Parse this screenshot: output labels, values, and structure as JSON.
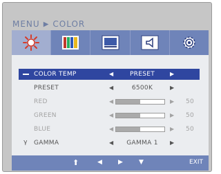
{
  "breadcrumb": {
    "menu": "MENU",
    "separator": "▶",
    "section": "COLOR"
  },
  "tabs": [
    {
      "icon": "brightness-sun-icon",
      "active": true
    },
    {
      "icon": "color-bars-icon",
      "active": false
    },
    {
      "icon": "monitor-picture-icon",
      "active": false
    },
    {
      "icon": "speaker-volume-icon",
      "active": false
    },
    {
      "icon": "settings-gear-icon",
      "active": false
    }
  ],
  "rows": [
    {
      "label": "COLOR TEMP",
      "value": "PRESET",
      "selected": true
    },
    {
      "label": "PRESET",
      "value": "6500K"
    },
    {
      "label": "RED",
      "level_percent": 50,
      "number": "50",
      "disabled": true
    },
    {
      "label": "GREEN",
      "level_percent": 50,
      "number": "50",
      "disabled": true
    },
    {
      "label": "BLUE",
      "level_percent": 50,
      "number": "50",
      "disabled": true
    },
    {
      "label": "GAMMA",
      "value": "GAMMA 1",
      "mark": "γ"
    }
  ],
  "arrows": {
    "left": "◀",
    "right": "▶"
  },
  "footer": {
    "up": "⬆",
    "left": "◀",
    "right": "▶",
    "down": "▼",
    "exit": "EXIT"
  },
  "colors": {
    "accent": "#6f84b9",
    "selected_row": "#2f46a0",
    "panel": "#ebedf0",
    "header_text": "#6e7ea3"
  }
}
